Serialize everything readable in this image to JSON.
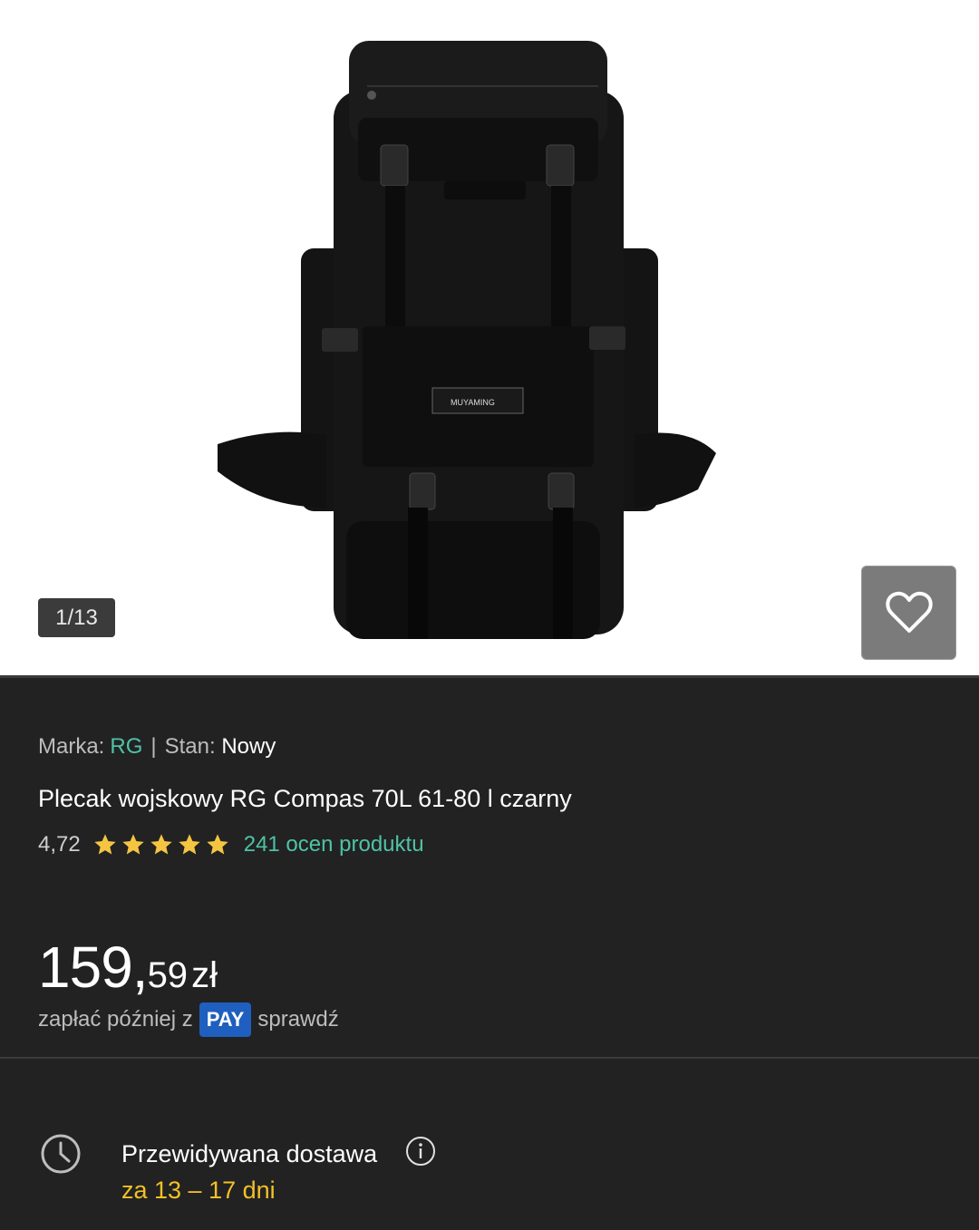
{
  "gallery": {
    "counter": "1/13",
    "image_icon": "backpack-photo",
    "logo_text": "MUYAMING",
    "favorite_icon": "heart-outline-icon"
  },
  "product": {
    "brand_label": "Marka:",
    "brand_value": "RG",
    "separator": "|",
    "condition_label": "Stan:",
    "condition_value": "Nowy",
    "title": "Plecak wojskowy RG Compas 70L 61-80 l czarny",
    "rating_value": "4,72",
    "stars": 5,
    "reviews_text": "241 ocen produktu"
  },
  "price": {
    "main": "159,",
    "cents": "59",
    "currency": "zł"
  },
  "pay_later": {
    "prefix": "zapłać później z",
    "badge": "PAY",
    "action": "sprawdź"
  },
  "delivery": {
    "icon": "clock-icon",
    "label": "Przewidywana dostawa",
    "info_icon": "info-icon",
    "time": "za 13 – 17 dni"
  },
  "colors": {
    "accent_teal": "#4ec3a6",
    "star_yellow": "#f5c542",
    "delivery_yellow": "#f2c028",
    "pay_blue": "#1f5fbf",
    "background": "#222222"
  }
}
